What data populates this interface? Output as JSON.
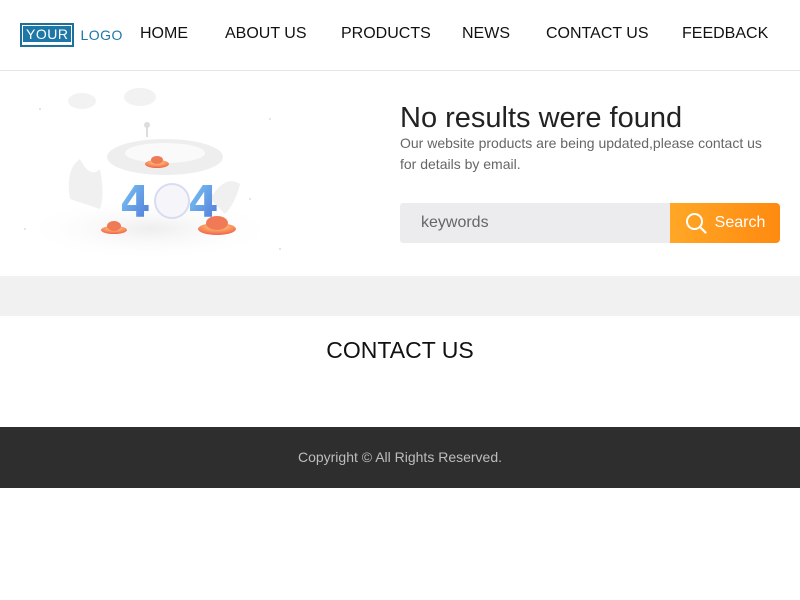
{
  "header": {
    "logo": {
      "box_text": "YOUR",
      "text": "LOGO"
    },
    "nav": [
      {
        "label": "HOME"
      },
      {
        "label": "ABOUT US"
      },
      {
        "label": "PRODUCTS"
      },
      {
        "label": "NEWS"
      },
      {
        "label": "CONTACT US"
      },
      {
        "label": "FEEDBACK"
      }
    ]
  },
  "hero": {
    "illustration_digits": "404",
    "title": "No results were found",
    "description": "Our website products are being updated,please contact us for details by email.",
    "search": {
      "placeholder": "keywords",
      "button_label": "Search",
      "button_icon": "search-icon"
    }
  },
  "contact": {
    "title": "CONTACT US"
  },
  "footer": {
    "copyright": "Copyright © All Rights Reserved."
  },
  "colors": {
    "logo_blue": "#1d78a8",
    "search_button": "#ff9a1a",
    "input_bg": "#ececee",
    "band_bg": "#f1f1f1",
    "footer_bg": "#2e2e2e"
  }
}
